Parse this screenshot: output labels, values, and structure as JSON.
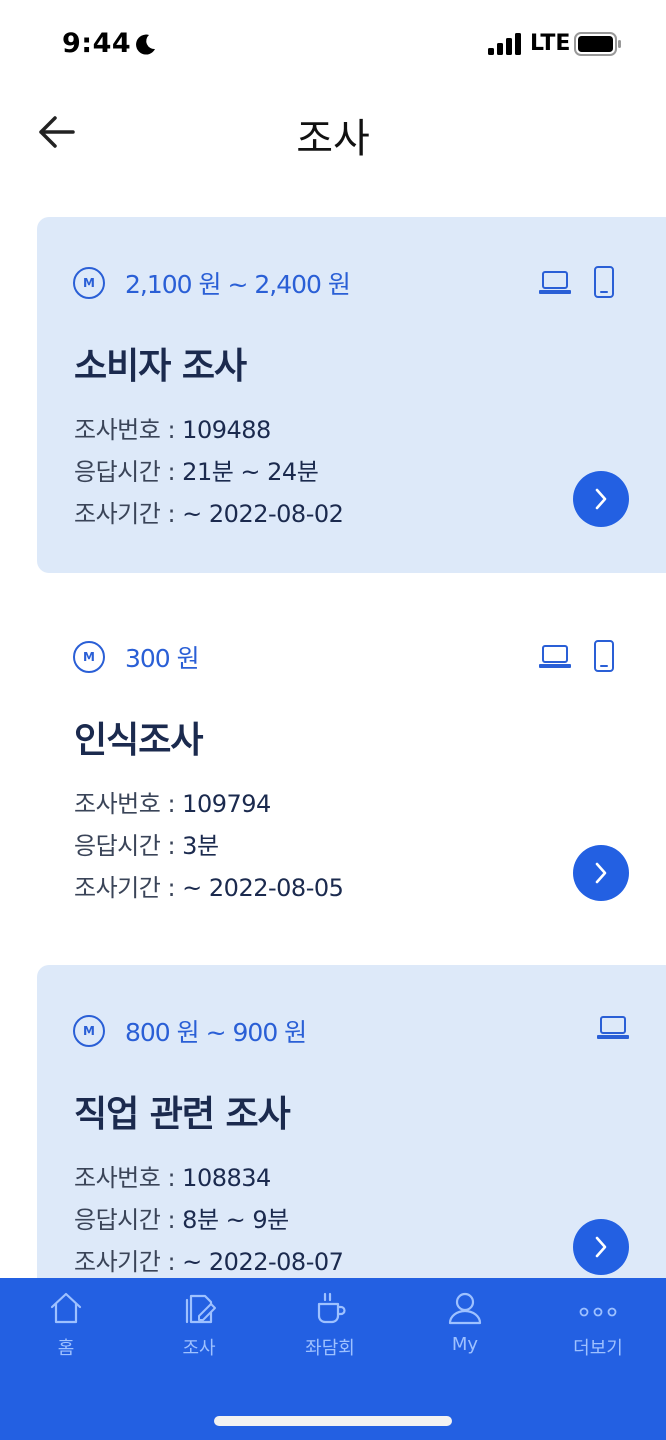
{
  "status_bar": {
    "time": "9:44",
    "network": "LTE"
  },
  "header": {
    "title": "조사",
    "back_icon": "arrow-left-icon"
  },
  "surveys": [
    {
      "reward": "2,100 원 ~ 2,400 원",
      "title": "소비자 조사",
      "number_label": "조사번호 : ",
      "number": "109488",
      "time_label": "응답시간 : ",
      "time": "21분 ~ 24분",
      "period_label": "조사기간 : ",
      "period": "~ 2022-08-02",
      "devices": [
        "laptop-icon",
        "phone-icon"
      ]
    },
    {
      "reward": "300 원",
      "title": "인식조사",
      "number_label": "조사번호 : ",
      "number": "109794",
      "time_label": "응답시간 : ",
      "time": "3분",
      "period_label": "조사기간 : ",
      "period": "~ 2022-08-05",
      "devices": [
        "laptop-icon",
        "phone-icon"
      ]
    },
    {
      "reward": "800 원 ~ 900 원",
      "title": "직업 관련 조사",
      "number_label": "조사번호 : ",
      "number": "108834",
      "time_label": "응답시간 : ",
      "time": "8분 ~ 9분",
      "period_label": "조사기간 : ",
      "period": "~ 2022-08-07",
      "devices": [
        "laptop-icon"
      ]
    }
  ],
  "coin_symbol": "M",
  "nav": {
    "items": [
      {
        "label": "홈",
        "icon": "home-icon"
      },
      {
        "label": "조사",
        "icon": "survey-icon"
      },
      {
        "label": "좌담회",
        "icon": "cup-icon"
      },
      {
        "label": "My",
        "icon": "user-icon"
      },
      {
        "label": "더보기",
        "icon": "more-icon"
      }
    ]
  },
  "colors": {
    "accent": "#2360e2",
    "card_tint": "#dde9f9",
    "text_dark": "#1b2a4e",
    "nav_label": "#9ec1ff"
  }
}
